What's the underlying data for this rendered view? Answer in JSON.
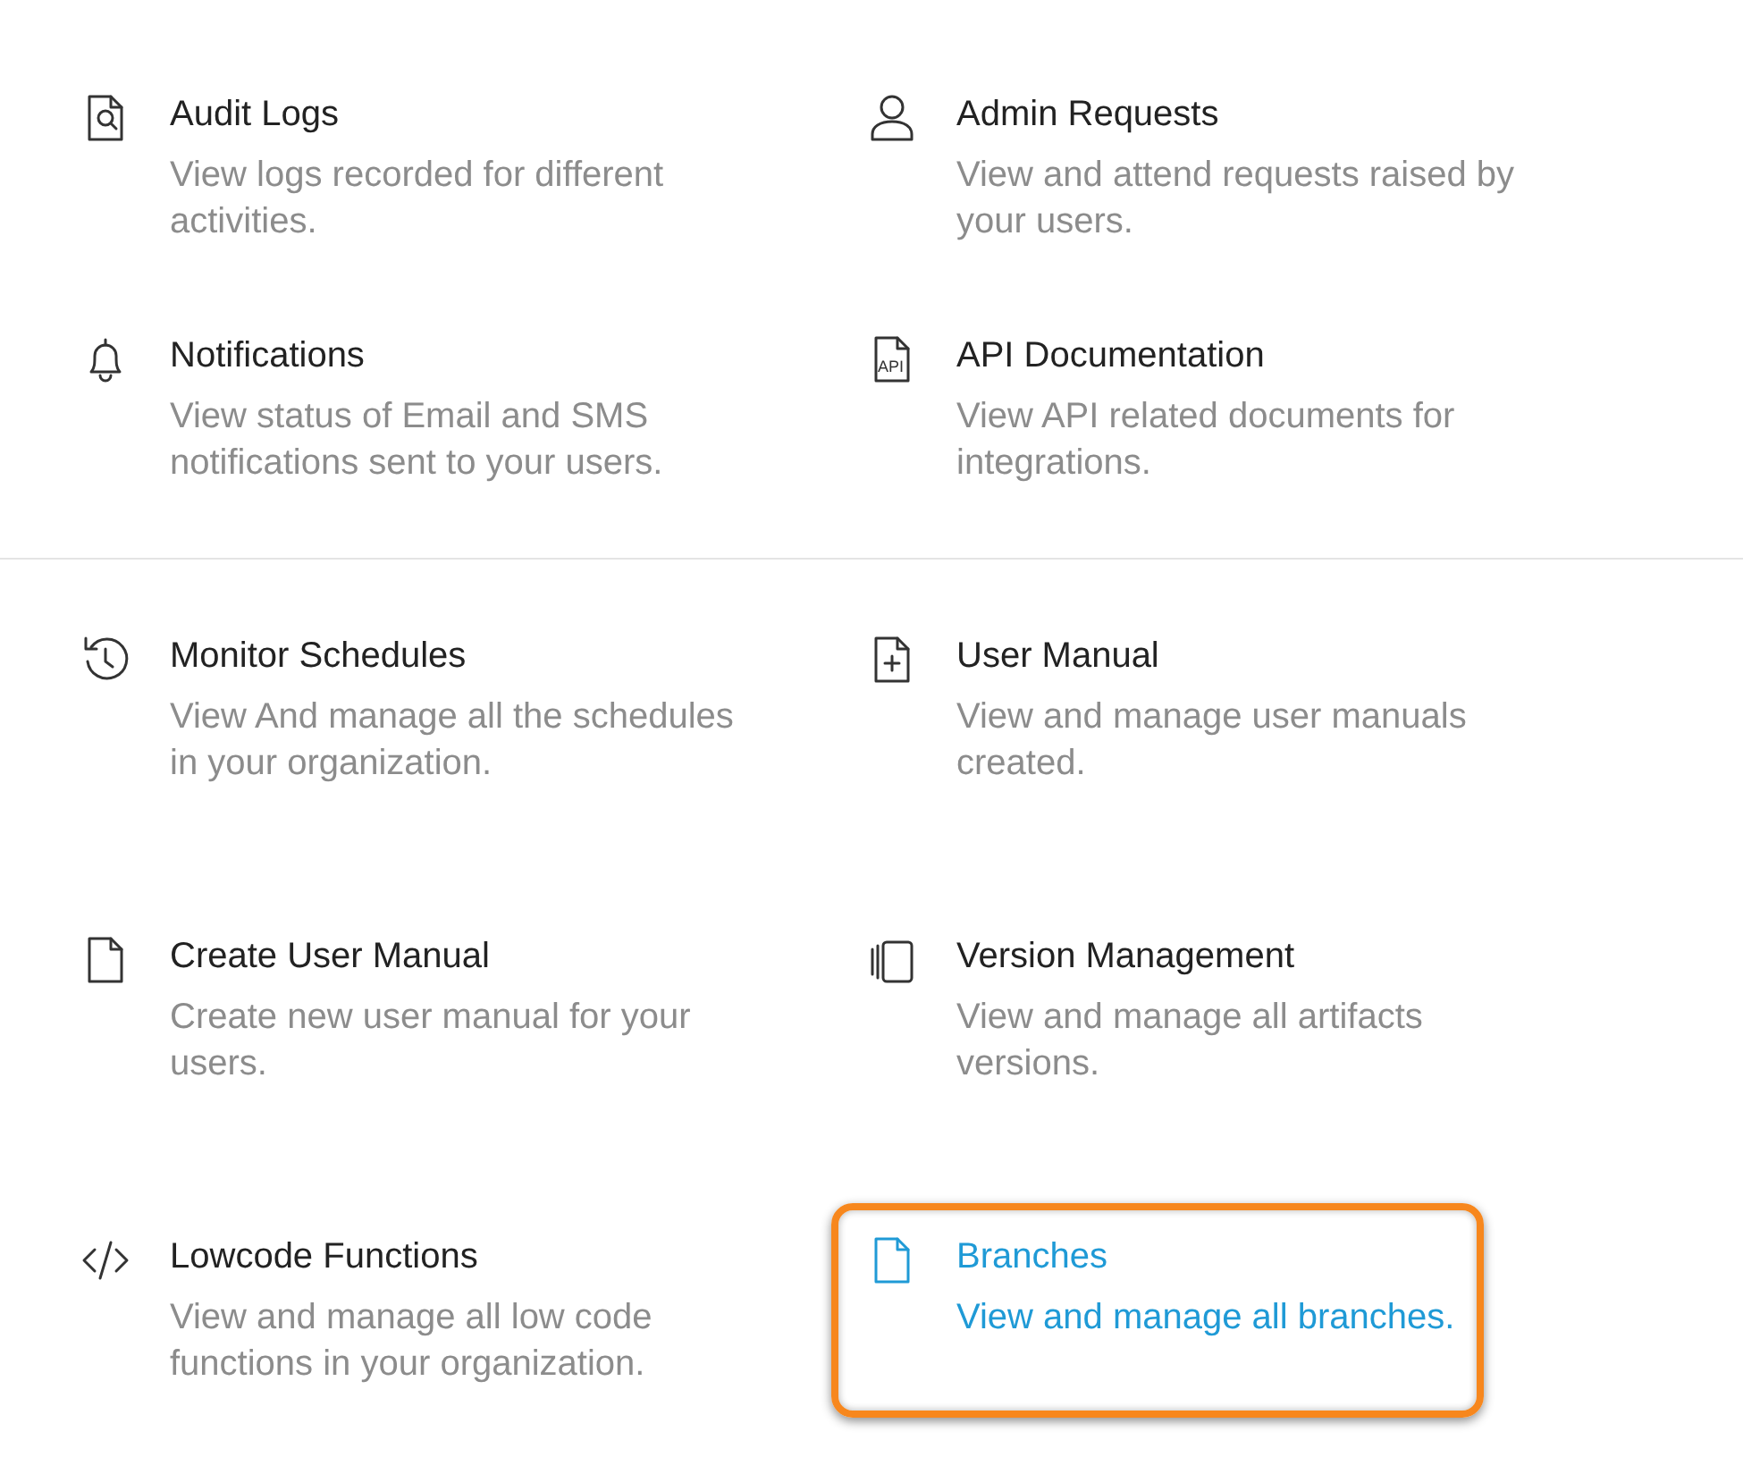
{
  "sections": [
    {
      "items": [
        {
          "kind": "doc-search",
          "title": "Audit Logs",
          "description": "View logs recorded for different activities.",
          "selected": false
        },
        {
          "kind": "user",
          "title": "Admin Requests",
          "description": "View and attend requests raised by your users.",
          "selected": false
        },
        {
          "kind": "bell",
          "title": "Notifications",
          "description": "View status of Email and SMS notifications sent to your users.",
          "selected": false
        },
        {
          "kind": "doc-label",
          "icon_text": "API",
          "title": "API Documentation",
          "description": "View API related documents for integrations.",
          "selected": false
        }
      ]
    },
    {
      "items": [
        {
          "kind": "history",
          "title": "Monitor Schedules",
          "description": "View And manage all the schedules in your organization.",
          "selected": false
        },
        {
          "kind": "doc-plus",
          "title": "User Manual",
          "description": "View and manage user manuals created.",
          "selected": false
        },
        {
          "kind": "doc",
          "title": "Create User Manual",
          "description": "Create new user manual for your users.",
          "selected": false
        },
        {
          "kind": "versions",
          "title": "Version Management",
          "description": "View and manage all artifacts versions.",
          "selected": false
        },
        {
          "kind": "code",
          "title": "Lowcode Functions",
          "description": "View and manage all low code functions in your organization.",
          "selected": false
        },
        {
          "kind": "doc",
          "title": "Branches",
          "description": "View and manage all branches.",
          "selected": true
        }
      ]
    }
  ]
}
